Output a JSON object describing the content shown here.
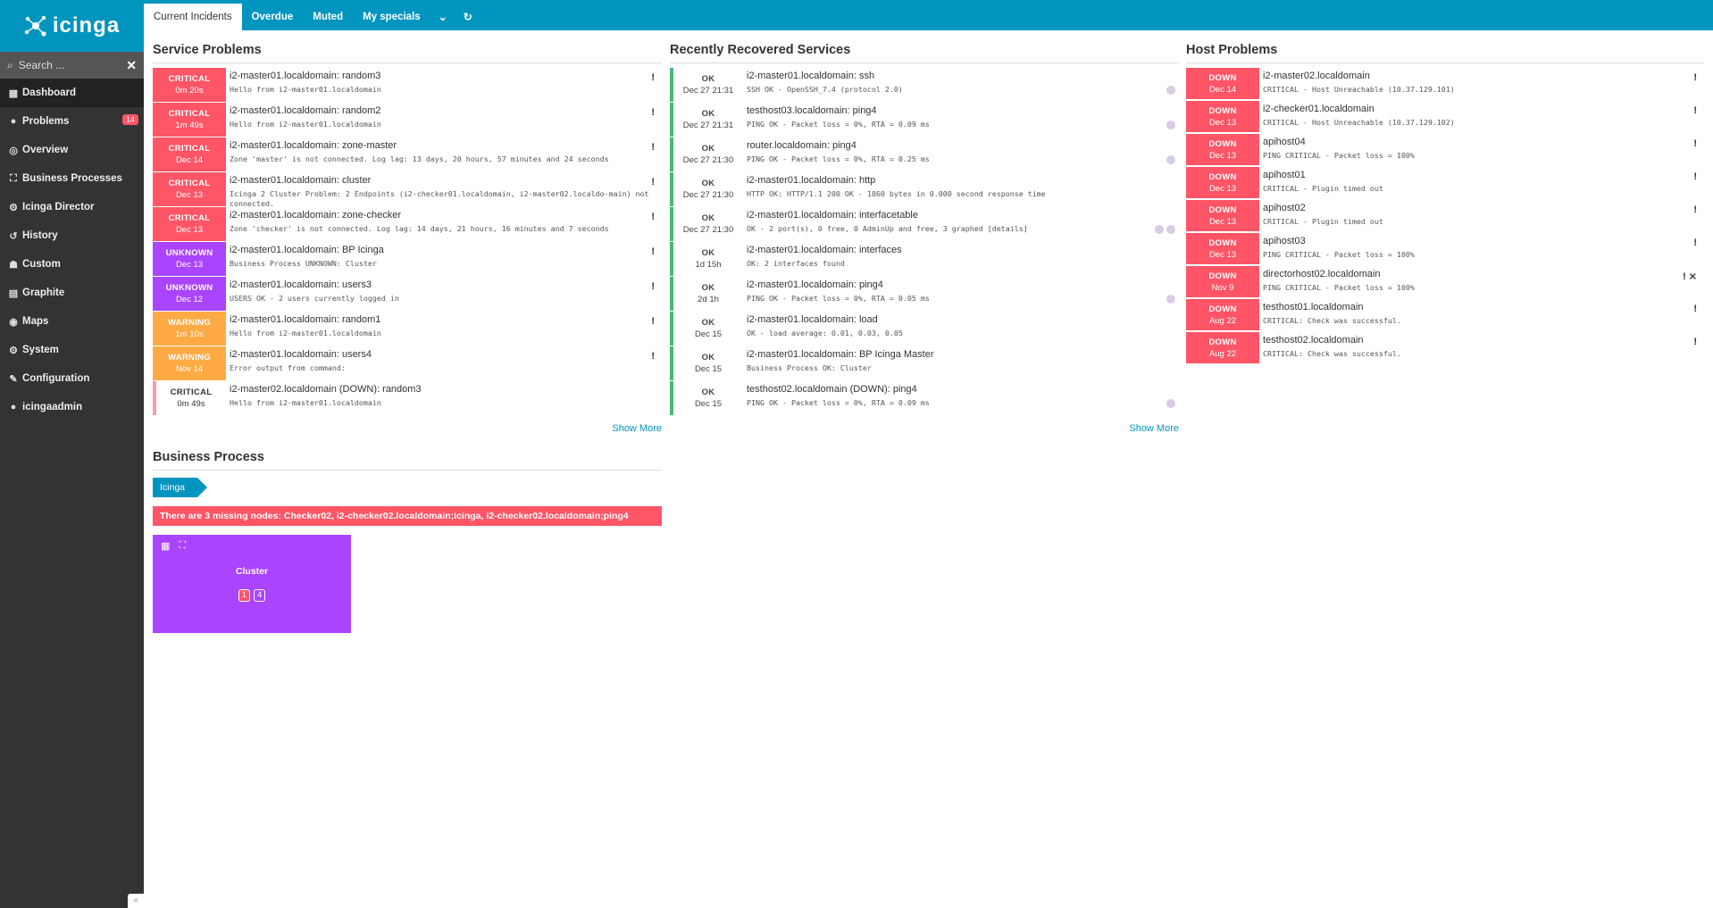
{
  "app": {
    "logo_text": "icinga"
  },
  "search": {
    "placeholder": "Search ..."
  },
  "sidebar": {
    "items": [
      {
        "label": "Dashboard",
        "icon": "dashboard-icon",
        "glyph": "▦",
        "active": true
      },
      {
        "label": "Problems",
        "icon": "problems-icon",
        "glyph": "●",
        "badge": "14"
      },
      {
        "label": "Overview",
        "icon": "binoculars-icon",
        "glyph": "◎"
      },
      {
        "label": "Business Processes",
        "icon": "sitemap-icon",
        "glyph": "⛶"
      },
      {
        "label": "Icinga Director",
        "icon": "director-icon",
        "glyph": "⚙"
      },
      {
        "label": "History",
        "icon": "history-icon",
        "glyph": "↺"
      },
      {
        "label": "Custom",
        "icon": "custom-icon",
        "glyph": "☗"
      },
      {
        "label": "Graphite",
        "icon": "graphite-icon",
        "glyph": "▤"
      },
      {
        "label": "Maps",
        "icon": "maps-icon",
        "glyph": "◉"
      },
      {
        "label": "System",
        "icon": "system-icon",
        "glyph": "⚙"
      },
      {
        "label": "Configuration",
        "icon": "wrench-icon",
        "glyph": "✎"
      },
      {
        "label": "icingaadmin",
        "icon": "user-icon",
        "glyph": "●"
      }
    ]
  },
  "tabs": [
    {
      "label": "Current Incidents",
      "active": true
    },
    {
      "label": "Overdue"
    },
    {
      "label": "Muted"
    },
    {
      "label": "My specials"
    }
  ],
  "tab_icons": {
    "dropdown": "⌄",
    "refresh": "↻"
  },
  "service_problems": {
    "title": "Service Problems",
    "rows": [
      {
        "state": "CRITICAL",
        "since": "0m 20s",
        "cls": "crit",
        "title": "i2-master01.localdomain: random3",
        "output": "Hello from i2-master01.localdomain",
        "flag": "!"
      },
      {
        "state": "CRITICAL",
        "since": "1m 49s",
        "cls": "crit",
        "title": "i2-master01.localdomain: random2",
        "output": "Hello from i2-master01.localdomain",
        "flag": "!"
      },
      {
        "state": "CRITICAL",
        "since": "Dec 14",
        "cls": "crit",
        "title": "i2-master01.localdomain: zone-master",
        "output": "Zone 'master' is not connected. Log lag: 13 days, 20 hours, 57 minutes and 24 seconds",
        "flag": "!"
      },
      {
        "state": "CRITICAL",
        "since": "Dec 13",
        "cls": "crit",
        "title": "i2-master01.localdomain: cluster",
        "output": "Icinga 2 Cluster Problem: 2 Endpoints (i2-checker01.localdomain, i2-master02.localdo-main) not connected.",
        "flag": "!"
      },
      {
        "state": "CRITICAL",
        "since": "Dec 13",
        "cls": "crit",
        "title": "i2-master01.localdomain: zone-checker",
        "output": "Zone 'checker' is not connected. Log lag: 14 days, 21 hours, 16 minutes and 7 seconds",
        "flag": "!"
      },
      {
        "state": "UNKNOWN",
        "since": "Dec 13",
        "cls": "unk",
        "title": "i2-master01.localdomain: BP Icinga",
        "output": "Business Process UNKNOWN: Cluster",
        "flag": "!"
      },
      {
        "state": "UNKNOWN",
        "since": "Dec 12",
        "cls": "unk",
        "title": "i2-master01.localdomain: users3",
        "output": "USERS OK - 2 users currently logged in",
        "flag": "!"
      },
      {
        "state": "WARNING",
        "since": "1m 10s",
        "cls": "warn",
        "title": "i2-master01.localdomain: random1",
        "output": "Hello from i2-master01.localdomain",
        "flag": "!"
      },
      {
        "state": "WARNING",
        "since": "Nov 14",
        "cls": "warn",
        "title": "i2-master01.localdomain: users4",
        "output": "Error output from command:",
        "flag": "!"
      },
      {
        "state": "CRITICAL",
        "since": "0m 49s",
        "cls": "crit-soft",
        "title": "i2-master02.localdomain (DOWN): random3",
        "output": "Hello from i2-master01.localdomain",
        "flag": ""
      }
    ],
    "show_more": "Show More"
  },
  "recovered": {
    "title": "Recently Recovered Services",
    "rows": [
      {
        "state": "OK",
        "since": "Dec 27 21:31",
        "title": "i2-master01.localdomain: ssh",
        "output": "SSH OK - OpenSSH_7.4 (protocol 2.0)",
        "dots": 1
      },
      {
        "state": "OK",
        "since": "Dec 27 21:31",
        "title": "testhost03.localdomain: ping4",
        "output": "PING OK - Packet loss = 0%, RTA = 0.09 ms",
        "dots": 1
      },
      {
        "state": "OK",
        "since": "Dec 27 21:30",
        "title": "router.localdomain: ping4",
        "output": "PING OK - Packet loss = 0%, RTA = 0.25 ms",
        "dots": 1
      },
      {
        "state": "OK",
        "since": "Dec 27 21:30",
        "title": "i2-master01.localdomain: http",
        "output": "HTTP OK: HTTP/1.1 200 OK - 1860 bytes in 0.000 second response time",
        "dots": 0
      },
      {
        "state": "OK",
        "since": "Dec 27 21:30",
        "title": "i2-master01.localdomain: interfacetable",
        "output": "OK - 2 port(s), 0 free, 0 AdminUp and free, 3 graphed [details]",
        "dots": 2
      },
      {
        "state": "OK",
        "since": "1d 15h",
        "title": "i2-master01.localdomain: interfaces",
        "output": "OK: 2 interfaces found",
        "dots": 0
      },
      {
        "state": "OK",
        "since": "2d 1h",
        "title": "i2-master01.localdomain: ping4",
        "output": "PING OK - Packet loss = 0%, RTA = 0.05 ms",
        "dots": 1
      },
      {
        "state": "OK",
        "since": "Dec 15",
        "title": "i2-master01.localdomain: load",
        "output": "OK - load average: 0.01, 0.03, 0.05",
        "dots": 0
      },
      {
        "state": "OK",
        "since": "Dec 15",
        "title": "i2-master01.localdomain: BP Icinga Master",
        "output": "Business Process OK: Cluster",
        "dots": 0
      },
      {
        "state": "OK",
        "since": "Dec 15",
        "title": "testhost02.localdomain (DOWN): ping4",
        "output": "PING OK - Packet loss = 0%, RTA = 0.09 ms",
        "dots": 1
      }
    ],
    "show_more": "Show More"
  },
  "host_problems": {
    "title": "Host Problems",
    "rows": [
      {
        "state": "DOWN",
        "since": "Dec 14",
        "title": "i2-master02.localdomain",
        "output": "CRITICAL - Host Unreachable (10.37.129.101)",
        "flag": "!"
      },
      {
        "state": "DOWN",
        "since": "Dec 13",
        "title": "i2-checker01.localdomain",
        "output": "CRITICAL - Host Unreachable (10.37.129.102)",
        "flag": "!"
      },
      {
        "state": "DOWN",
        "since": "Dec 13",
        "title": "apihost04",
        "output": "PING CRITICAL - Packet loss = 100%",
        "flag": "!"
      },
      {
        "state": "DOWN",
        "since": "Dec 13",
        "title": "apihost01",
        "output": "CRITICAL - Plugin timed out",
        "flag": "!"
      },
      {
        "state": "DOWN",
        "since": "Dec 13",
        "title": "apihost02",
        "output": "CRITICAL - Plugin timed out",
        "flag": "!"
      },
      {
        "state": "DOWN",
        "since": "Dec 13",
        "title": "apihost03",
        "output": "PING CRITICAL - Packet loss = 100%",
        "flag": "!"
      },
      {
        "state": "DOWN",
        "since": "Nov 9",
        "title": "directorhost02.localdomain",
        "output": "PING CRITICAL - Packet loss = 100%",
        "flag": "! ⨯"
      },
      {
        "state": "DOWN",
        "since": "Aug 22",
        "title": "testhost01.localdomain",
        "output": "CRITICAL: Check was successful.",
        "flag": "!"
      },
      {
        "state": "DOWN",
        "since": "Aug 22",
        "title": "testhost02.localdomain",
        "output": "CRITICAL: Check was successful.",
        "flag": "!"
      }
    ]
  },
  "business_process": {
    "title": "Business Process",
    "breadcrumb": "Icinga",
    "error": "There are 3 missing nodes: Checker02, i2-checker02.localdomain;icinga, i2-checker02.localdomain;ping4",
    "tile": {
      "name": "Cluster",
      "count_critical": "1",
      "count_total": "4"
    }
  },
  "colors": {
    "brand": "#0095bf",
    "critical": "#ff5566",
    "unknown": "#aa44ff",
    "warning": "#ffaa44",
    "ok": "#44bb77"
  }
}
